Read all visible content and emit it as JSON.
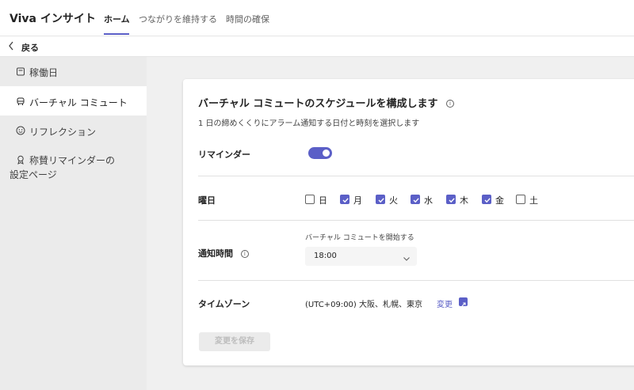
{
  "header": {
    "app_title": "Viva インサイト",
    "tabs": [
      {
        "label": "ホーム"
      },
      {
        "label": "つながりを維持する"
      },
      {
        "label": "時間の確保"
      }
    ]
  },
  "back": {
    "label": "戻る",
    "icon": "chevron-left-icon"
  },
  "sidebar": {
    "items": [
      {
        "label": "稼働日",
        "icon": "calendar-icon"
      },
      {
        "label": "バーチャル コミュート",
        "icon": "vehicle-icon"
      },
      {
        "label": "リフレクション",
        "icon": "smiley-icon"
      },
      {
        "label": "称賛リマインダーの設定ページ",
        "icon": "ribbon-icon"
      }
    ]
  },
  "card": {
    "title": "バーチャル コミュートのスケジュールを構成します",
    "info_glyph": "i",
    "subtitle": "1 日の締めくくりにアラーム通知する日付と時刻を選択します",
    "reminder": {
      "label": "リマインダー",
      "enabled": true
    },
    "weekday": {
      "label": "曜日",
      "days": [
        {
          "label": "日",
          "checked": false
        },
        {
          "label": "月",
          "checked": true
        },
        {
          "label": "火",
          "checked": true
        },
        {
          "label": "水",
          "checked": true
        },
        {
          "label": "木",
          "checked": true
        },
        {
          "label": "金",
          "checked": true
        },
        {
          "label": "土",
          "checked": false
        }
      ]
    },
    "notify": {
      "label": "通知時間",
      "caption": "バーチャル コミュートを開始する",
      "time_value": "18:00"
    },
    "timezone": {
      "label": "タイムゾーン",
      "value": "(UTC+09:00) 大阪、札幌、東京",
      "change_label": "変更"
    },
    "save_label": "変更を保存"
  },
  "colors": {
    "accent": "#5b5fc7",
    "sidebar_bg": "#ebebeb",
    "page_bg": "#f0f0f0"
  }
}
